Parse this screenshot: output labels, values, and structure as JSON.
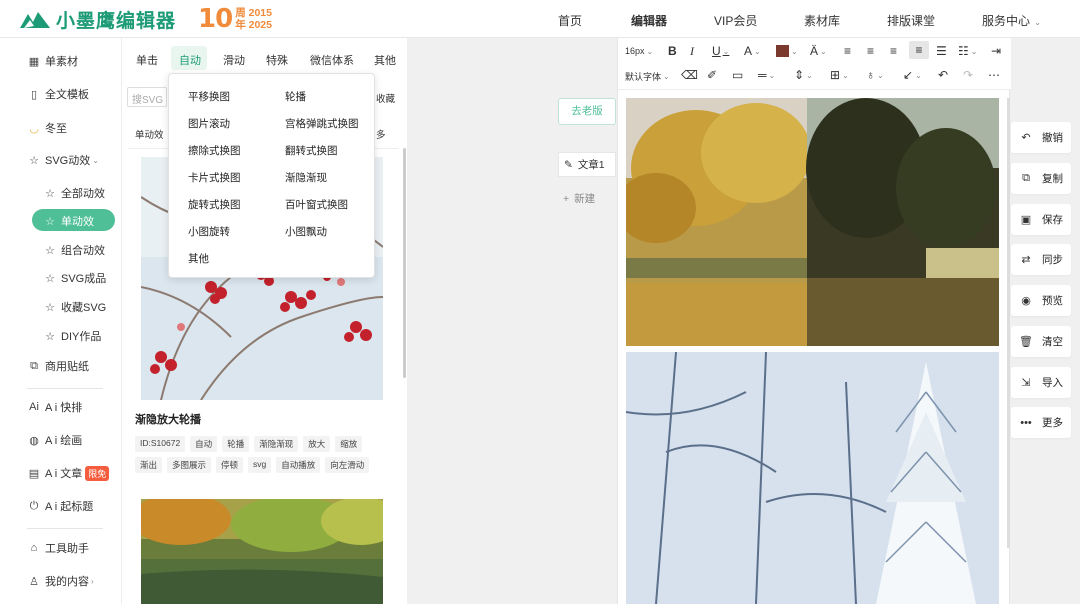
{
  "brand": {
    "name": "小墨鹰编辑器",
    "anniversary_num": "10",
    "anniversary_line1": "周 2015",
    "anniversary_line2": "年 2025",
    "color": "#1d9b76"
  },
  "nav": {
    "items": [
      "首页",
      "编辑器",
      "VIP会员",
      "素材库",
      "排版课堂",
      "服务中心"
    ],
    "active": "编辑器"
  },
  "sidebar": {
    "items": [
      {
        "label": "单素材",
        "icon": "grid-icon"
      },
      {
        "label": "全文模板",
        "icon": "template-icon"
      },
      {
        "label": "冬至",
        "icon": "dumpling-icon"
      },
      {
        "label": "SVG动效",
        "icon": "star-icon"
      },
      {
        "label": "全部动效",
        "icon": "star-icon"
      },
      {
        "label": "单动效",
        "icon": "star-icon"
      },
      {
        "label": "组合动效",
        "icon": "star-icon"
      },
      {
        "label": "SVG成品",
        "icon": "star-icon"
      },
      {
        "label": "收藏SVG",
        "icon": "star-icon"
      },
      {
        "label": "DIY作品",
        "icon": "star-icon"
      },
      {
        "label": "商用贴纸",
        "icon": "puzzle-icon"
      },
      {
        "label": "A i 快排",
        "icon": "ai-icon"
      },
      {
        "label": "A i 绘画",
        "icon": "palette-icon"
      },
      {
        "label": "A i 文章",
        "icon": "doc-icon",
        "badge": "限免"
      },
      {
        "label": "A i 起标题",
        "icon": "power-icon"
      },
      {
        "label": "工具助手",
        "icon": "tools-icon"
      },
      {
        "label": "我的内容",
        "icon": "user-icon"
      }
    ]
  },
  "panel": {
    "tabs": [
      "单击",
      "自动",
      "滑动",
      "特殊",
      "微信体系",
      "其他"
    ],
    "active_tab": "自动",
    "search_placeholder": "搜SVG",
    "collect_label": "收藏",
    "subtag_left": "单动效",
    "subtag_right": "多",
    "card": {
      "title": "渐隐放大轮播",
      "tags_row1": [
        "ID:S10672",
        "自动",
        "轮播",
        "渐隐渐现",
        "放大",
        "缩放"
      ],
      "tags_row2": [
        "渐出",
        "多图展示",
        "停顿",
        "svg",
        "自动播放",
        "向左滑动"
      ]
    }
  },
  "dropdown": {
    "items_left": [
      "平移换图",
      "图片滚动",
      "擦除式换图",
      "卡片式换图",
      "旋转式换图",
      "小图旋转",
      "其他"
    ],
    "items_right": [
      "轮播",
      "宫格弹跳式换图",
      "翻转式换图",
      "渐隐渐现",
      "百叶窗式换图",
      "小图飘动"
    ]
  },
  "canvas": {
    "old_button": "去老版",
    "doc_label": "文章1",
    "new_label": "新建"
  },
  "toolbar": {
    "font_size": "16px",
    "font_family": "默认字体"
  },
  "actions": [
    "撤销",
    "复制",
    "保存",
    "同步",
    "预览",
    "清空",
    "导入",
    "更多"
  ]
}
